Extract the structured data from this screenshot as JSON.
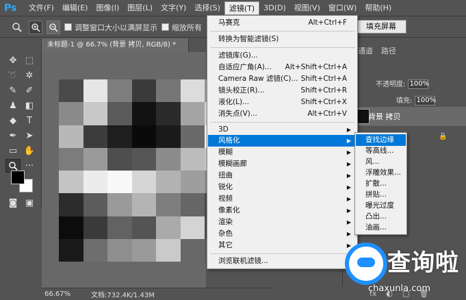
{
  "menubar": {
    "logo": "Ps",
    "items": [
      "文件(F)",
      "编辑(E)",
      "图像(I)",
      "图层(L)",
      "文字(Y)",
      "选择(S)",
      "滤镜(T)",
      "3D(D)",
      "视图(V)",
      "窗口(W)",
      "帮助(H)"
    ]
  },
  "optbar": {
    "check1": "调整窗口大小以满屏显示",
    "check2": "缩放所有",
    "fill_screen": "填充屏幕"
  },
  "document": {
    "tab_title": "未标题-1 @ 66.7% (背景 拷贝, RGB/8) *",
    "zoom": "66.67%",
    "doc_info": "文档:732.4K/1.43M",
    "mosaic": [
      [
        "#4a4a4a",
        "#e6e6e6",
        "#7e7e7e",
        "#3a3a3a",
        "#767676",
        "#dcdcdc",
        "#9a9a9a",
        "#5c5c5c"
      ],
      [
        "#8a8a8a",
        "#c8c8c8",
        "#5a5a5a",
        "#121212",
        "#2a2a2a",
        "#a4a4a4",
        "#d2d2d2",
        "#6e6e6e"
      ],
      [
        "#b8b8b8",
        "#3c3c3c",
        "#1e1e1e",
        "#0a0a0a",
        "#1a1a1a",
        "#6a6a6a",
        "#f0f0f0",
        "#9c9c9c"
      ],
      [
        "#7c7c7c",
        "#9a9a9a",
        "#4e4e4e",
        "#565656",
        "#8c8c8c",
        "#bcbcbc",
        "#c6c6c6",
        "#7a7a7a"
      ],
      [
        "#c4c4c4",
        "#ececec",
        "#f8f8f8",
        "#d6d6d6",
        "#b2b2b2",
        "#9e9e9e",
        "#8a8a8a",
        "#b6b6b6"
      ],
      [
        "#2c2c2c",
        "#5c5c5c",
        "#9a9a9a",
        "#b4b4b4",
        "#7e7e7e",
        "#666666",
        "#4a4a4a",
        "#222222"
      ],
      [
        "#0c0c0c",
        "#3a3a3a",
        "#626262",
        "#545454",
        "#aaaaaa",
        "#d4d4d4",
        "#4c4c4c",
        "#1c1c1c"
      ],
      [
        "#1a1a1a",
        "#6e6e6e",
        "#8e8e8e",
        "#9a9a9a",
        "#cacaca",
        "#686868",
        "#5c5c5c",
        "#8c8c8c"
      ]
    ]
  },
  "panel": {
    "tab_channels": "通道",
    "tab_paths": "路径",
    "opacity_label": "不透明度:",
    "opacity_value": "100%",
    "fill_label": "填充:",
    "fill_value": "100%",
    "layer_name": "背景 拷贝",
    "foot_fx": "fx"
  },
  "filter_menu": {
    "items": [
      {
        "label": "马赛克",
        "shortcut": "Alt+Ctrl+F"
      },
      {
        "label": "转换为智能滤镜(S)",
        "shortcut": ""
      },
      {
        "label": "滤镜库(G)...",
        "shortcut": ""
      },
      {
        "label": "自适应广角(A)...",
        "shortcut": "Alt+Shift+Ctrl+A"
      },
      {
        "label": "Camera Raw 滤镜(C)...",
        "shortcut": "Shift+Ctrl+A"
      },
      {
        "label": "镜头校正(R)...",
        "shortcut": "Shift+Ctrl+R"
      },
      {
        "label": "液化(L)...",
        "shortcut": "Shift+Ctrl+X"
      },
      {
        "label": "消失点(V)...",
        "shortcut": "Alt+Ctrl+V"
      },
      {
        "label": "3D",
        "shortcut": ""
      },
      {
        "label": "风格化",
        "shortcut": ""
      },
      {
        "label": "模糊",
        "shortcut": ""
      },
      {
        "label": "模糊画廊",
        "shortcut": ""
      },
      {
        "label": "扭曲",
        "shortcut": ""
      },
      {
        "label": "锐化",
        "shortcut": ""
      },
      {
        "label": "视频",
        "shortcut": ""
      },
      {
        "label": "像素化",
        "shortcut": ""
      },
      {
        "label": "渲染",
        "shortcut": ""
      },
      {
        "label": "杂色",
        "shortcut": ""
      },
      {
        "label": "其它",
        "shortcut": ""
      },
      {
        "label": "浏览联机滤镜...",
        "shortcut": ""
      }
    ]
  },
  "stylize_submenu": {
    "items": [
      "查找边缘",
      "等高线...",
      "风...",
      "浮雕效果...",
      "扩散...",
      "拼贴...",
      "曝光过度",
      "凸出...",
      "油画..."
    ]
  },
  "watermark": {
    "text": "查询啦",
    "url": "chaxunla.com"
  }
}
